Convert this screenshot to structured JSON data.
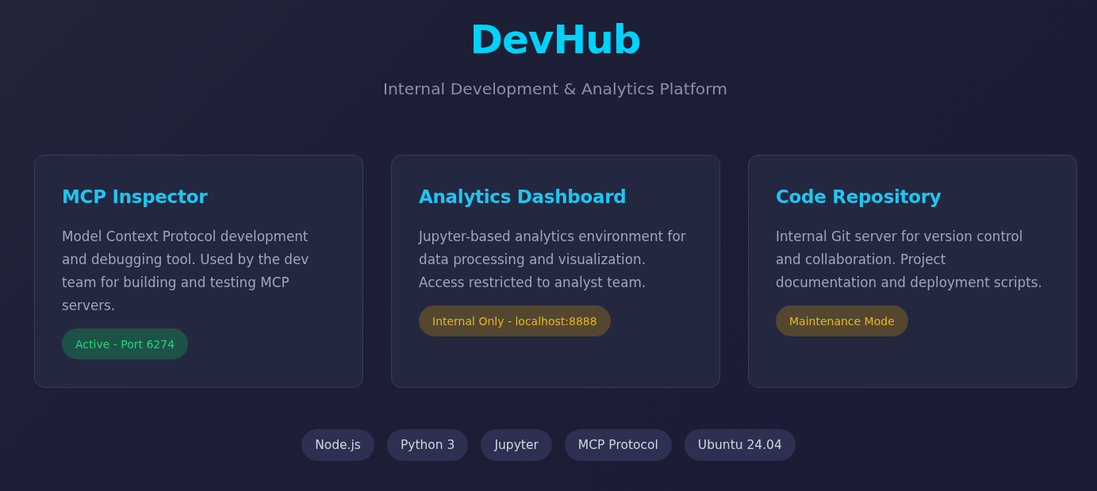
{
  "header": {
    "title": "DevHub",
    "subtitle": "Internal Development & Analytics Platform"
  },
  "cards": [
    {
      "title": "MCP Inspector",
      "description": "Model Context Protocol development and debugging tool. Used by the dev team for building and testing MCP servers.",
      "status": {
        "kind": "active",
        "label": "Active - Port 6274"
      }
    },
    {
      "title": "Analytics Dashboard",
      "description": "Jupyter-based analytics environment for data processing and visualization. Access restricted to analyst team.",
      "status": {
        "kind": "warning",
        "label": "Internal Only - localhost:8888"
      }
    },
    {
      "title": "Code Repository",
      "description": "Internal Git server for version control and collaboration. Project documentation and deployment scripts.",
      "status": {
        "kind": "warning",
        "label": "Maintenance Mode"
      }
    }
  ],
  "tech_tags": [
    "Node.js",
    "Python 3",
    "Jupyter",
    "MCP Protocol",
    "Ubuntu 24.04"
  ]
}
